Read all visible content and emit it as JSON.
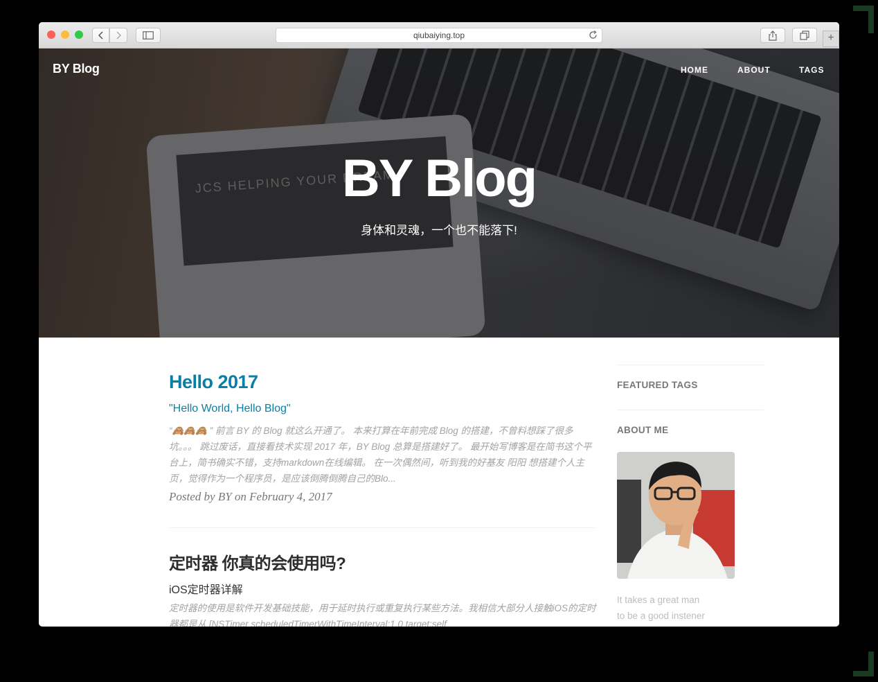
{
  "browser": {
    "url": "qiubaiying.top",
    "new_tab_label": "+"
  },
  "header": {
    "brand": "BY Blog",
    "nav": [
      "HOME",
      "ABOUT",
      "TAGS"
    ]
  },
  "hero": {
    "title": "BY Blog",
    "subtitle": "身体和灵魂，一个也不能落下!",
    "tablet_text": "JCS HELPING YOUR DREAM"
  },
  "posts": [
    {
      "title": "Hello 2017",
      "subtitle": "\"Hello World, Hello Blog\"",
      "excerpt": "“🙈🙈🙈 ” 前言 BY 的 Blog 就这么开通了。 本来打算在年前完成 Blog 的搭建，不曾料想踩了很多坑。。。 跳过废话，直接看技术实现 2017 年，BY Blog 总算是搭建好了。 最开始写博客是在简书这个平台上，简书确实不错，支持markdown在线编辑。 在一次偶然间，听到我的好基友 阳阳 想搭建个人主页，觉得作为一个程序员，是应该倒腾倒腾自己的Blo...",
      "meta": "Posted by BY on February 4, 2017"
    },
    {
      "title": "定时器 你真的会使用吗?",
      "subtitle": "iOS定时器详解",
      "excerpt": "定时器的使用是软件开发基础技能，用于延时执行或重复执行某些方法。我相信大部分人接触iOS的定时器都是从 [NSTimer scheduledTimerWithTimeInterval:1.0 target:self"
    }
  ],
  "sidebar": {
    "featured_tags": "FEATURED TAGS",
    "about_me": "ABOUT ME",
    "quote_line1": "It takes a great man",
    "quote_line2": "to be a good instener"
  },
  "colors": {
    "link": "#0a7fa6",
    "traffic_red": "#fc605c",
    "traffic_yellow": "#fdbc40",
    "traffic_green": "#34c84a"
  }
}
